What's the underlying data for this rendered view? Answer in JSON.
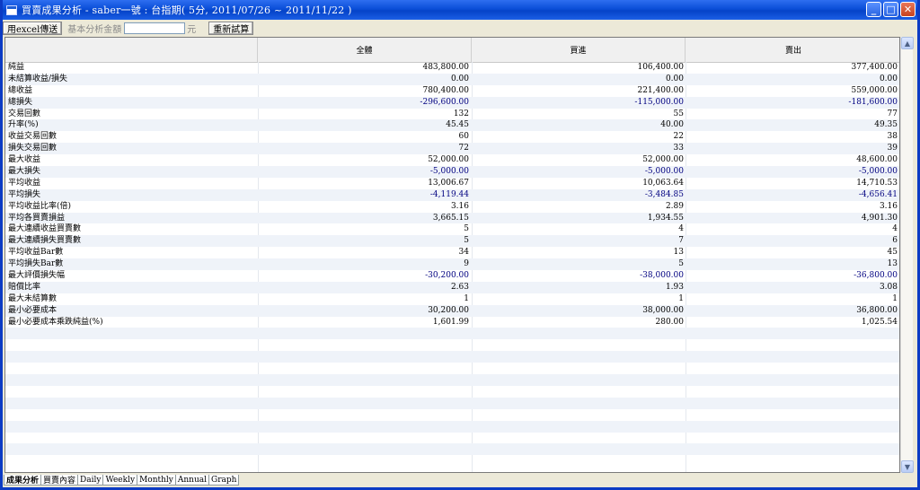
{
  "window": {
    "title": "買賣成果分析 - saber一號 : 台指期( 5分, 2011/07/26 ~ 2011/11/22 )"
  },
  "toolbar": {
    "export_label": "用excel傳送",
    "amount_label": "基本分析金額",
    "amount_value": "",
    "unit_label": "元",
    "retest_label": "重新試算"
  },
  "table": {
    "headers": [
      "全體",
      "買進",
      "賣出"
    ],
    "rows": [
      {
        "name": "純益",
        "v": [
          "483,800.00",
          "106,400.00",
          "377,400.00"
        ]
      },
      {
        "name": "未結算收益/損失",
        "v": [
          "0.00",
          "0.00",
          "0.00"
        ]
      },
      {
        "name": "總收益",
        "v": [
          "780,400.00",
          "221,400.00",
          "559,000.00"
        ]
      },
      {
        "name": "總損失",
        "v": [
          "-296,600.00",
          "-115,000.00",
          "-181,600.00"
        ]
      },
      {
        "name": "交易回數",
        "v": [
          "132",
          "55",
          "77"
        ]
      },
      {
        "name": "升率(%)",
        "v": [
          "45.45",
          "40.00",
          "49.35"
        ]
      },
      {
        "name": "收益交易回數",
        "v": [
          "60",
          "22",
          "38"
        ]
      },
      {
        "name": "損失交易回數",
        "v": [
          "72",
          "33",
          "39"
        ]
      },
      {
        "name": "最大收益",
        "v": [
          "52,000.00",
          "52,000.00",
          "48,600.00"
        ]
      },
      {
        "name": "最大損失",
        "v": [
          "-5,000.00",
          "-5,000.00",
          "-5,000.00"
        ]
      },
      {
        "name": "平均收益",
        "v": [
          "13,006.67",
          "10,063.64",
          "14,710.53"
        ]
      },
      {
        "name": "平均損失",
        "v": [
          "-4,119.44",
          "-3,484.85",
          "-4,656.41"
        ]
      },
      {
        "name": "平均收益比率(倍)",
        "v": [
          "3.16",
          "2.89",
          "3.16"
        ]
      },
      {
        "name": "平均各買賣損益",
        "v": [
          "3,665.15",
          "1,934.55",
          "4,901.30"
        ]
      },
      {
        "name": "最大連續收益買賣數",
        "v": [
          "5",
          "4",
          "4"
        ]
      },
      {
        "name": "最大連續損失買賣數",
        "v": [
          "5",
          "7",
          "6"
        ]
      },
      {
        "name": "平均收益Bar數",
        "v": [
          "34",
          "13",
          "45"
        ]
      },
      {
        "name": "平均損失Bar數",
        "v": [
          "9",
          "5",
          "13"
        ]
      },
      {
        "name": "最大評價損失幅",
        "v": [
          "-30,200.00",
          "-38,000.00",
          "-36,800.00"
        ]
      },
      {
        "name": "賠償比率",
        "v": [
          "2.63",
          "1.93",
          "3.08"
        ]
      },
      {
        "name": "最大未結算數",
        "v": [
          "1",
          "1",
          "1"
        ]
      },
      {
        "name": "最小必要成本",
        "v": [
          "30,200.00",
          "38,000.00",
          "36,800.00"
        ]
      },
      {
        "name": "最小必要成本乘跌純益(%)",
        "v": [
          "1,601.99",
          "280.00",
          "1,025.54"
        ]
      }
    ],
    "empty_rows": 12
  },
  "tabs": [
    "成果分析",
    "買賣內容",
    "Daily",
    "Weekly",
    "Monthly",
    "Annual",
    "Graph"
  ],
  "icons": {
    "up": "scroll-up-arrow",
    "down": "scroll-down-arrow"
  },
  "colors": {
    "negative": "#000080",
    "title_bar": "#0a4ed8"
  }
}
